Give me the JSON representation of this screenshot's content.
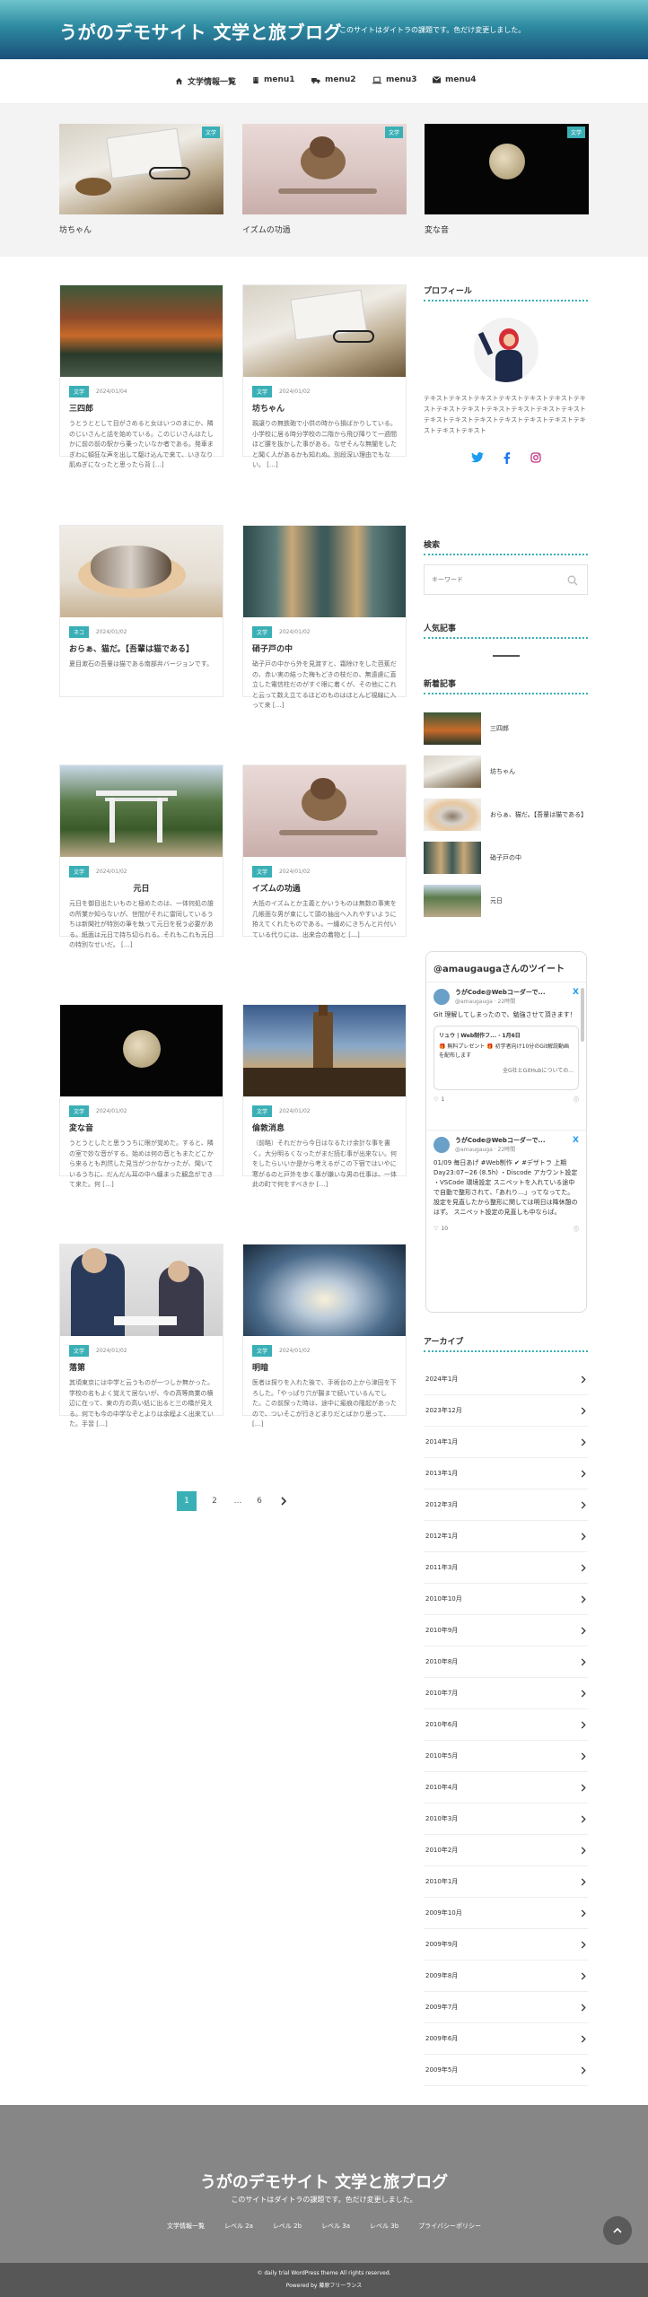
{
  "header": {
    "site_title": "うがのデモサイト 文学と旅ブログ",
    "site_description": "このサイトはダイトラの課題です。色だけ変更しました。"
  },
  "nav": [
    "文学情報一覧",
    "menu1",
    "menu2",
    "menu3",
    "menu4"
  ],
  "featured": [
    {
      "title": "坊ちゃん",
      "category": "文学"
    },
    {
      "title": "イズムの功過",
      "category": "文学"
    },
    {
      "title": "変な音",
      "category": "文学"
    }
  ],
  "posts": [
    {
      "title": "三四郎",
      "category": "文学",
      "date": "2024/01/04",
      "excerpt": "うとうととして目がさめると女はいつのまにか、隣のじいさんと話を始めている。このじいさんはたしかに前の前の駅から乗ったいなか者である。発車まぎわに頓狂な声を出して駆け込んで来て、いきなり肌ぬぎになったと思ったら背 […]"
    },
    {
      "title": "坊ちゃん",
      "category": "文学",
      "date": "2024/01/02",
      "excerpt": "親譲りの無鉄砲で小供の時から損ばかりしている。小学校に居る時分学校の二階から飛び降りて一週間ほど腰を抜かした事がある。なぜそんな無闇をしたと聞く人があるかも知れぬ。別段深い理由でもない。 […]"
    },
    {
      "title": "おらぁ、猫だ。【吾輩は猫である】",
      "category": "ネコ",
      "date": "2024/01/02",
      "excerpt": "夏目漱石の吾輩は猫である南部弁バージョンです。"
    },
    {
      "title": "硝子戸の中",
      "category": "文学",
      "date": "2024/01/02",
      "excerpt": "硝子戸の中から外を見渡すと、霜除けをした芭蕉だの、赤い実の結った梅もどきの枝だの、無遠慮に直立した電信柱だのがすぐ眼に着くが、その他にこれと云って数え立てるほどのものはほとんど視線に入って来 […]"
    },
    {
      "title": "元日",
      "category": "文学",
      "date": "2024/01/02",
      "excerpt": "元日を御目出たいものと極めたのは、一体何処の誰の所業か知らないが、世間がそれに雷同しているうちは新聞社が特別の筆を執って元日を祝う必要がある。紙面は元日で持ち切られる。それもこれも元日の特別なせいだ。 […]"
    },
    {
      "title": "イズムの功過",
      "category": "文学",
      "date": "2024/01/02",
      "excerpt": "大抵のイズムとか主義とかいうものは無数の事実を几帳面な男が束にして頭の抽出へ入れやすいように拵えてくれたものである。一纏めにきちんと片付いている代りには、出来合の着物と […]"
    },
    {
      "title": "変な音",
      "category": "文学",
      "date": "2024/01/02",
      "excerpt": "うとうとしたと思ううちに眼が覚めた。すると、隣の室で妙な音がする。始めは何の音ともまたどこから来るとも判然した見当がつかなかったが、聞いているうちに、だんだん耳の中へ纏まった観念ができて来た。何 […]"
    },
    {
      "title": "倫敦消息",
      "category": "文学",
      "date": "2024/01/02",
      "excerpt": "（前略）それだから今日はなるたけ余計な事を書く。大分明るくなったがまだ読む事が出来ない。何をしたらいいか是から考えるがこの下宿ではいやに寒がるのと戸外を歩く事が嫌いな男の仕事は、一体此の町で何をすべきか […]"
    },
    {
      "title": "落第",
      "category": "文学",
      "date": "2024/01/02",
      "excerpt": "其頃東京には中学と云うものが一つしか無かった。学校の名もよく覚えて居ないが、今の高等商業の横辺に在って、東の方の高い処に出ると三の橋が見える。何でも今の中学なぞとよりは余程よく出来ていた。手習 […]"
    },
    {
      "title": "明暗",
      "category": "文学",
      "date": "2024/01/02",
      "excerpt": "医者は探りを入れた後で、手術台の上から津田を下ろした。「やっぱり穴が腸まで続いているんでした。この前探った時は、途中に瘢痕の隆起があったので、ついそこが行きどまりだとばかり思って、 […]"
    }
  ],
  "pagination": [
    "1",
    "2",
    "…",
    "6"
  ],
  "sidebar": {
    "profile_title": "プロフィール",
    "profile_text": "テキストテキストテキストテキストテキストテキストテキストテキストテキストテキストテキストテキストテキストテキストテキストテキストテキストテキストテキストテキストテキストテキスト",
    "search_title": "検索",
    "search_placeholder": "キーワード",
    "popular_title": "人気記事",
    "recent_title": "新着記事",
    "recent": [
      "三四郎",
      "坊ちゃん",
      "おらぁ、猫だ。【吾輩は猫である】",
      "硝子戸の中",
      "元日"
    ],
    "archive_title": "アーカイブ",
    "archive": [
      "2024年1月",
      "2023年12月",
      "2014年1月",
      "2013年1月",
      "2012年3月",
      "2012年1月",
      "2011年3月",
      "2010年10月",
      "2010年9月",
      "2010年8月",
      "2010年7月",
      "2010年6月",
      "2010年5月",
      "2010年4月",
      "2010年3月",
      "2010年2月",
      "2010年1月",
      "2009年10月",
      "2009年9月",
      "2009年8月",
      "2009年7月",
      "2009年6月",
      "2009年5月"
    ]
  },
  "twitter": {
    "header": "@amaugaugaさんのツイート",
    "tweets": [
      {
        "name": "うがCode@Webコーダーで...",
        "handle": "@amaugauga · 22時間",
        "text": "Git 理解してしまったので、勉強させて頂きます！",
        "quote_name": "リュウ | Web制作フ... · 1月6日",
        "quote_text": "🎁 無料プレゼント 🎁 初学者向け10分のGit解説動画を配布します",
        "quote_more": "全G社とGitHubについての...",
        "likes": "1"
      },
      {
        "name": "うがCode@Webコーダーで...",
        "handle": "@amaugauga · 22時間",
        "text": "01/09 毎日あげ #Web制作 ✔ #デザトラ 上期Day23:07~26 (8.5h) ・Discode アカウント設定 ・VSCode 環境設定 スニペットを入れている途中で自動で整形されて、「あれり…」ってなってた。 設定を見直したから整形に関しては明日は降休憩のはず。 スニペット設定の見直しも中ならば。",
        "likes": "10"
      }
    ]
  },
  "footer": {
    "title": "うがのデモサイト 文学と旅ブログ",
    "description": "このサイトはダイトラの課題です。色だけ変更しました。",
    "links": [
      "文学情報一覧",
      "レベル 2a",
      "レベル 2b",
      "レベル 3a",
      "レベル 3b",
      "プライバシーポリシー"
    ],
    "copyright": "© daily trial WordPress theme All rights reserved.",
    "powered": "Powered by 藤原フリーランス"
  },
  "colors": {
    "accent": "#3ab0b6",
    "header_dark": "#1b4f7a",
    "footer": "#868686"
  }
}
